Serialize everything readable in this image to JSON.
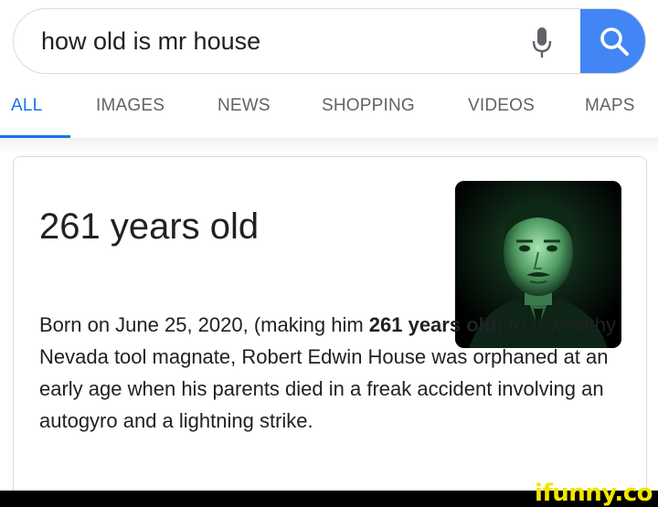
{
  "search": {
    "query": "how old is mr house"
  },
  "tabs": [
    {
      "label": "ALL",
      "active": true
    },
    {
      "label": "IMAGES",
      "active": false
    },
    {
      "label": "NEWS",
      "active": false
    },
    {
      "label": "SHOPPING",
      "active": false
    },
    {
      "label": "VIDEOS",
      "active": false
    },
    {
      "label": "MAPS",
      "active": false
    }
  ],
  "result": {
    "answer": "261 years old",
    "description_pre": "Born on June 25, 2020, (making him ",
    "description_bold": "261 years old",
    "description_post": ") to a wealthy Nevada tool magnate, Robert Edwin House was orphaned at an early age when his parents died in a freak accident involving an autogyro and a lightning strike."
  },
  "icons": {
    "mic": "microphone-icon",
    "search": "search-icon"
  },
  "colors": {
    "accent": "#1a73e8",
    "search_button": "#4285f4",
    "portrait_glow": "#7dcf8f"
  },
  "watermark": "ifunny.co"
}
